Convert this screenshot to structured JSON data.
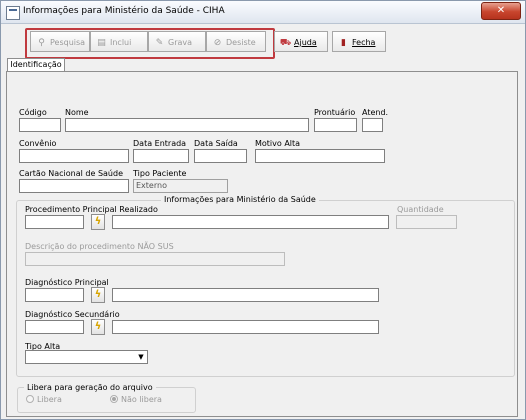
{
  "window": {
    "title": "Informações para Ministério da Saúde - CIHA",
    "close_glyph": "✕"
  },
  "toolbar": {
    "pesquisa": {
      "label": "Pesquisa",
      "icon": "search-icon"
    },
    "inclui": {
      "label": "Inclui",
      "icon": "add-document-icon"
    },
    "grava": {
      "label": "Grava",
      "icon": "save-icon"
    },
    "desiste": {
      "label": "Desiste",
      "icon": "cancel-icon"
    },
    "ajuda": {
      "label": "Ajuda",
      "icon": "help-icon"
    },
    "fecha": {
      "label": "Fecha",
      "icon": "exit-icon"
    }
  },
  "tabs": [
    {
      "label": "Identificação",
      "selected": true
    }
  ],
  "form": {
    "codigo": {
      "label": "Código",
      "value": ""
    },
    "nome": {
      "label": "Nome",
      "value": ""
    },
    "prontuario": {
      "label": "Prontuário",
      "value": ""
    },
    "atend": {
      "label": "Atend.",
      "value": ""
    },
    "convenio": {
      "label": "Convênio",
      "value": ""
    },
    "data_entrada": {
      "label": "Data Entrada",
      "value": ""
    },
    "data_saida": {
      "label": "Data Saída",
      "value": ""
    },
    "motivo_alta": {
      "label": "Motivo Alta",
      "value": ""
    },
    "cartao_sus": {
      "label": "Cartão Nacional de Saúde",
      "value": ""
    },
    "tipo_paciente": {
      "label": "Tipo Paciente",
      "value": "Externo"
    }
  },
  "ms_group": {
    "title": "Informações para Ministério da Saúde",
    "proc_principal": {
      "label": "Procedimento Principal Realizado",
      "code": "",
      "desc": ""
    },
    "quantidade": {
      "label": "Quantidade",
      "value": ""
    },
    "desc_nao_sus": {
      "label": "Descrição do procedimento NÃO SUS",
      "value": ""
    },
    "diag_principal": {
      "label": "Diagnóstico Principal",
      "code": "",
      "desc": ""
    },
    "diag_secundario": {
      "label": "Diagnóstico Secundário",
      "code": "",
      "desc": ""
    },
    "tipo_alta": {
      "label": "Tipo Alta",
      "value": ""
    }
  },
  "libera_group": {
    "title": "Libera para geração do arquivo",
    "options": [
      {
        "label": "Libera",
        "selected": false
      },
      {
        "label": "Não libera",
        "selected": true
      }
    ]
  },
  "colors": {
    "highlight_border": "#c03a3f",
    "lookup_bolt": "#d7a400"
  }
}
